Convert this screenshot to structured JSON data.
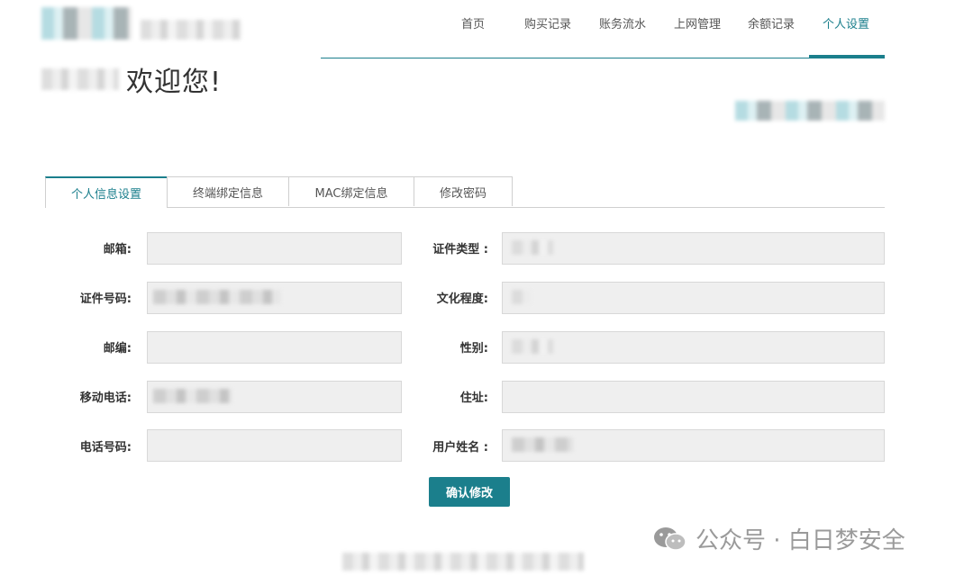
{
  "nav": {
    "items": [
      "首页",
      "购买记录",
      "账务流水",
      "上网管理",
      "余额记录",
      "个人设置"
    ],
    "active_index": 5
  },
  "welcome": "欢迎您!",
  "tabs": [
    "个人信息设置",
    "终端绑定信息",
    "MAC绑定信息",
    "修改密码"
  ],
  "active_tab": 0,
  "form": {
    "left": [
      {
        "label": "邮箱:",
        "value": ""
      },
      {
        "label": "证件号码:",
        "value": ""
      },
      {
        "label": "邮编:",
        "value": ""
      },
      {
        "label": "移动电话:",
        "value": ""
      },
      {
        "label": "电话号码:",
        "value": ""
      }
    ],
    "right": [
      {
        "label": "证件类型 :",
        "value": ""
      },
      {
        "label": "文化程度:",
        "value": ""
      },
      {
        "label": "性别:",
        "value": ""
      },
      {
        "label": "住址:",
        "value": ""
      },
      {
        "label": "用户姓名 :",
        "value": ""
      }
    ]
  },
  "submit_label": "确认修改",
  "watermark": "公众号 · 白日梦安全",
  "colors": {
    "accent": "#1b7f8c",
    "field_bg": "#efefef"
  }
}
